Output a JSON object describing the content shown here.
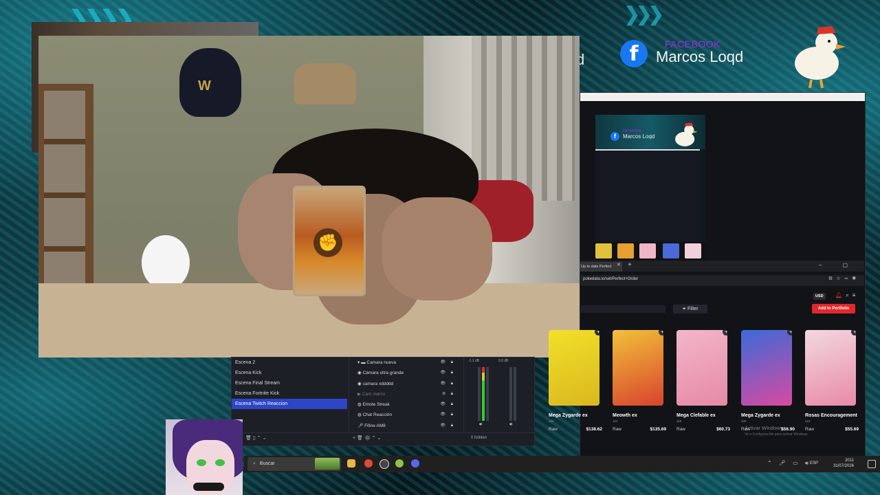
{
  "social": {
    "platform_label": "FACEBOOK",
    "name": "Marcos Loqd",
    "cut_text": "d"
  },
  "obs": {
    "scenes": [
      {
        "label": "Escena 2",
        "active": false
      },
      {
        "label": "Escena Kick",
        "active": false
      },
      {
        "label": "Escena Final Stream",
        "active": false
      },
      {
        "label": "Escena Fortnite Kick",
        "active": false
      },
      {
        "label": "Escena Twitch Reaccion",
        "active": true
      }
    ],
    "sources": [
      {
        "label": "Camara nueva",
        "icon": "folder-icon",
        "visible": true
      },
      {
        "label": "Cámara ultra grande",
        "icon": "camera-icon",
        "visible": true
      },
      {
        "label": "camara xddddd",
        "icon": "camera-icon",
        "visible": true
      },
      {
        "label": "Cam marco",
        "icon": "play-icon",
        "visible": false
      },
      {
        "label": "Emote Streak",
        "icon": "globe-icon",
        "visible": true
      },
      {
        "label": "Chat Reacción",
        "icon": "globe-icon",
        "visible": true
      },
      {
        "label": "Fifine AM8",
        "icon": "mic-icon",
        "visible": true
      }
    ],
    "mixer_db": [
      "-1.1 dB",
      "0.0 dB"
    ],
    "hidden_count": "0 hidden"
  },
  "taskbar": {
    "search_placeholder": "Buscar",
    "language": "ESP",
    "time": "2011",
    "date": "31/07/2026"
  },
  "nested": {
    "fb_label": "FACEBOOK",
    "name": "Marcos Loqd"
  },
  "browser": {
    "tab_title": "Up to date Perfect",
    "url": "pokedata.io/set/Perfect+Order",
    "currency": "USD",
    "filter_label": "Filter",
    "add_portfolio_label": "Add to Portfolio"
  },
  "cards": [
    {
      "name": "Mega Zygarde ex",
      "number": "124",
      "condition": "Raw",
      "price": "$138.62",
      "colors": [
        "#f2e02a",
        "#d9b81e"
      ]
    },
    {
      "name": "Meowth ex",
      "number": "121",
      "condition": "Raw",
      "price": "$135.69",
      "colors": [
        "#f2c13a",
        "#d8432e"
      ]
    },
    {
      "name": "Mega Clefable ex",
      "number": "119",
      "condition": "Raw",
      "price": "$60.73",
      "colors": [
        "#f3b6c8",
        "#e58aa6"
      ]
    },
    {
      "name": "Mega Zygarde ex",
      "number": "120",
      "condition": "Raw",
      "price": "$56.90",
      "colors": [
        "#3c6ad8",
        "#d84aa0"
      ]
    },
    {
      "name": "Rosas Encouragement",
      "number": "123",
      "condition": "Raw",
      "price": "$55.69",
      "colors": [
        "#f2d8e0",
        "#e88aa8"
      ]
    }
  ],
  "watermark": {
    "line1": "Activar Windows",
    "line2": "Ve a Configuración para activar Windows."
  },
  "colors": {
    "accent_teal": "#1fb8d0",
    "facebook_blue": "#1877f2",
    "obs_active": "#2d45c6",
    "add_red": "#e2282c"
  }
}
